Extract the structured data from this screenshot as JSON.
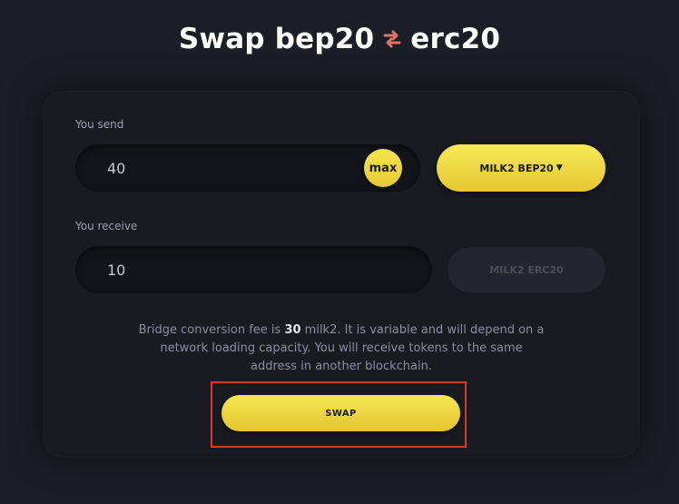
{
  "header": {
    "title_left": "Swap bep20",
    "title_right": "erc20",
    "swap_icon": "swap-arrows-icon",
    "swap_icon_color": "#e0726a"
  },
  "send": {
    "label": "You send",
    "amount": "40",
    "max_label": "max",
    "token_label": "MILK2 BEP20",
    "token_caret": "▼"
  },
  "receive": {
    "label": "You receive",
    "amount": "10",
    "token_label": "MILK2 ERC20"
  },
  "info": {
    "fee_prefix": "Bridge conversion fee is ",
    "fee_amount": "30",
    "fee_suffix": " milk2. It is variable and will depend on a network loading capacity. You will receive tokens to the same address in another blockchain."
  },
  "actions": {
    "swap_label": "SWAP"
  },
  "colors": {
    "accent_yellow": "#f3e24b",
    "background": "#1d1e25",
    "card": "#1a1b21",
    "highlight": "#d9392b"
  }
}
